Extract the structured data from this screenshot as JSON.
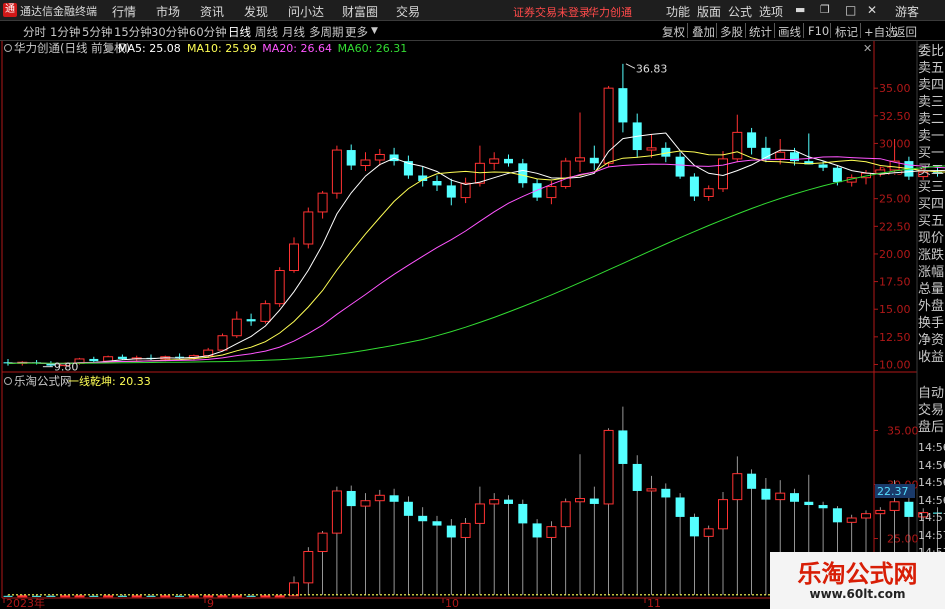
{
  "app": {
    "title": "通达信金融终端",
    "logo": "通",
    "menu": [
      "行情",
      "市场",
      "资讯",
      "发现",
      "问小达",
      "财富圈",
      "交易"
    ],
    "notice": "证券交易未登录",
    "stock_name": "华力创通",
    "right_menu": [
      "功能",
      "版面",
      "公式",
      "选项"
    ],
    "guest": "游客"
  },
  "toolbar": {
    "periods": [
      "分时",
      "1分钟",
      "5分钟",
      "15分钟",
      "30分钟",
      "60分钟",
      "日线",
      "周线",
      "月线",
      "多周期",
      "更多"
    ],
    "active": "日线",
    "right": [
      "复权",
      "叠加",
      "多股",
      "统计",
      "画线",
      "F10",
      "标记",
      "+自选",
      "返回"
    ]
  },
  "main_panel": {
    "title": "华力创通(日线 前复权)",
    "ma": [
      {
        "label": "MA5: 25.08",
        "color": "#ffffff"
      },
      {
        "label": "MA10: 25.99",
        "color": "#ffff55"
      },
      {
        "label": "MA20: 26.64",
        "color": "#ff55ff"
      },
      {
        "label": "MA60: 26.31",
        "color": "#33dd33"
      }
    ],
    "high_label": "36.83",
    "low_label": "9.80",
    "y_ticks": [
      "35.00",
      "32.50",
      "30.00",
      "27.50",
      "25.00",
      "22.50",
      "20.00",
      "17.50",
      "15.00",
      "12.50",
      "10.00"
    ]
  },
  "sub_panel": {
    "title": "乐淘公式网",
    "indicator": "一线乾坤: 20.33",
    "y_ticks": [
      "35.00",
      "30.00",
      "25.00",
      "20.00"
    ],
    "current_label": "22.37"
  },
  "x_labels": [
    "2023年",
    "9",
    "10",
    "11"
  ],
  "side_panel": [
    "委比",
    "卖五",
    "卖四",
    "卖三",
    "卖二",
    "卖一",
    "买一",
    "买二",
    "买三",
    "买四",
    "买五",
    "现价",
    "涨跌",
    "涨幅",
    "总量",
    "外盘",
    "换手",
    "净资",
    "收益"
  ],
  "side_panel_lower": [
    "自动",
    "交易",
    "盘后"
  ],
  "side_times": [
    "14:56",
    "14:56",
    "14:56",
    "14:56",
    "14:57",
    "14:57",
    "14:57"
  ],
  "watermark": {
    "title": "乐淘公式网",
    "url": "www.60lt.com"
  },
  "colors": {
    "up": "#ff3232",
    "down": "#54ffff",
    "ma5": "#ffffff",
    "ma10": "#ffff55",
    "ma20": "#ff55ff",
    "ma60": "#33dd33",
    "axis": "#b01818"
  },
  "chart_data": {
    "type": "candlestick",
    "title": "华力创通(日线 前复权)",
    "x_tick_labels": [
      "2023年",
      "9",
      "10",
      "11"
    ],
    "ylim": [
      9.5,
      38
    ],
    "candles": [
      [
        10.2,
        10.5,
        9.9,
        10.1
      ],
      [
        10.1,
        10.3,
        9.9,
        10.2
      ],
      [
        10.2,
        10.4,
        10.0,
        10.1
      ],
      [
        10.1,
        10.3,
        9.8,
        9.9
      ],
      [
        9.9,
        10.2,
        9.8,
        10.1
      ],
      [
        10.1,
        10.6,
        10.0,
        10.5
      ],
      [
        10.5,
        10.7,
        10.2,
        10.3
      ],
      [
        10.3,
        10.8,
        10.2,
        10.7
      ],
      [
        10.7,
        10.9,
        10.4,
        10.5
      ],
      [
        10.5,
        10.8,
        10.3,
        10.6
      ],
      [
        10.6,
        10.9,
        10.4,
        10.5
      ],
      [
        10.5,
        10.8,
        10.3,
        10.7
      ],
      [
        10.7,
        11.0,
        10.5,
        10.6
      ],
      [
        10.6,
        10.9,
        10.4,
        10.8
      ],
      [
        10.8,
        11.5,
        10.6,
        11.3
      ],
      [
        11.3,
        12.8,
        11.2,
        12.6
      ],
      [
        12.6,
        14.8,
        12.4,
        14.1
      ],
      [
        14.1,
        14.6,
        13.5,
        13.9
      ],
      [
        13.9,
        15.8,
        13.7,
        15.5
      ],
      [
        15.5,
        18.8,
        15.2,
        18.5
      ],
      [
        18.5,
        21.5,
        18.3,
        20.9
      ],
      [
        20.9,
        24.2,
        20.5,
        23.8
      ],
      [
        23.8,
        25.7,
        23.2,
        25.5
      ],
      [
        25.5,
        29.8,
        25.0,
        29.4
      ],
      [
        29.4,
        29.9,
        27.6,
        28.0
      ],
      [
        28.0,
        29.2,
        27.5,
        28.5
      ],
      [
        28.5,
        29.5,
        28.0,
        29.0
      ],
      [
        29.0,
        29.6,
        28.0,
        28.4
      ],
      [
        28.4,
        28.9,
        26.8,
        27.1
      ],
      [
        27.1,
        27.9,
        26.1,
        26.6
      ],
      [
        26.6,
        27.1,
        25.7,
        26.2
      ],
      [
        26.2,
        26.8,
        24.4,
        25.1
      ],
      [
        25.1,
        26.9,
        24.6,
        26.4
      ],
      [
        26.4,
        29.8,
        26.1,
        28.2
      ],
      [
        28.2,
        29.2,
        27.6,
        28.6
      ],
      [
        28.6,
        29.0,
        27.9,
        28.2
      ],
      [
        28.2,
        28.6,
        26.0,
        26.4
      ],
      [
        26.4,
        26.8,
        24.8,
        25.1
      ],
      [
        25.1,
        26.6,
        24.5,
        26.1
      ],
      [
        26.1,
        28.7,
        25.9,
        28.4
      ],
      [
        28.4,
        32.8,
        27.4,
        28.7
      ],
      [
        28.7,
        29.8,
        27.6,
        28.2
      ],
      [
        28.2,
        35.2,
        27.9,
        35.0
      ],
      [
        35.0,
        37.2,
        31.0,
        31.9
      ],
      [
        31.9,
        32.7,
        28.7,
        29.4
      ],
      [
        29.4,
        30.8,
        28.7,
        29.6
      ],
      [
        29.6,
        30.1,
        28.3,
        28.8
      ],
      [
        28.8,
        29.2,
        26.8,
        27.0
      ],
      [
        27.0,
        27.3,
        24.8,
        25.2
      ],
      [
        25.2,
        26.2,
        24.8,
        25.9
      ],
      [
        25.9,
        29.3,
        25.6,
        28.6
      ],
      [
        28.6,
        32.6,
        28.3,
        31.0
      ],
      [
        31.0,
        31.4,
        29.0,
        29.6
      ],
      [
        29.6,
        30.6,
        28.3,
        28.6
      ],
      [
        28.6,
        30.4,
        28.1,
        29.2
      ],
      [
        29.2,
        29.6,
        28.0,
        28.4
      ],
      [
        28.4,
        30.9,
        28.1,
        28.1
      ],
      [
        28.1,
        28.4,
        27.5,
        27.8
      ],
      [
        27.8,
        28.0,
        26.2,
        26.5
      ],
      [
        26.5,
        27.2,
        26.1,
        26.9
      ],
      [
        26.9,
        27.6,
        26.3,
        27.3
      ],
      [
        27.3,
        27.9,
        27.0,
        27.6
      ],
      [
        27.6,
        30.4,
        27.4,
        28.4
      ],
      [
        28.4,
        28.8,
        26.7,
        27.0
      ],
      [
        27.0,
        27.8,
        26.7,
        27.4
      ],
      [
        27.4,
        27.9,
        27.0,
        27.3
      ],
      [
        27.3,
        28.0,
        27.1,
        27.8
      ],
      [
        27.8,
        28.0,
        27.2,
        27.5
      ],
      [
        27.5,
        27.9,
        27.0,
        27.2
      ],
      [
        27.2,
        27.5,
        26.5,
        26.7
      ],
      [
        26.7,
        27.2,
        26.2,
        26.9
      ],
      [
        26.9,
        27.4,
        26.1,
        26.3
      ],
      [
        26.3,
        26.8,
        25.4,
        25.7
      ],
      [
        25.7,
        26.8,
        25.2,
        26.5
      ],
      [
        26.5,
        26.9,
        25.3,
        25.5
      ],
      [
        25.5,
        25.7,
        24.7,
        24.9
      ],
      [
        24.9,
        25.0,
        24.0,
        24.3
      ]
    ],
    "ma5_last": 25.08,
    "ma10_last": 25.99,
    "ma20_last": 26.64,
    "ma60_last": 26.31,
    "sub_indicator_last": 20.33
  }
}
